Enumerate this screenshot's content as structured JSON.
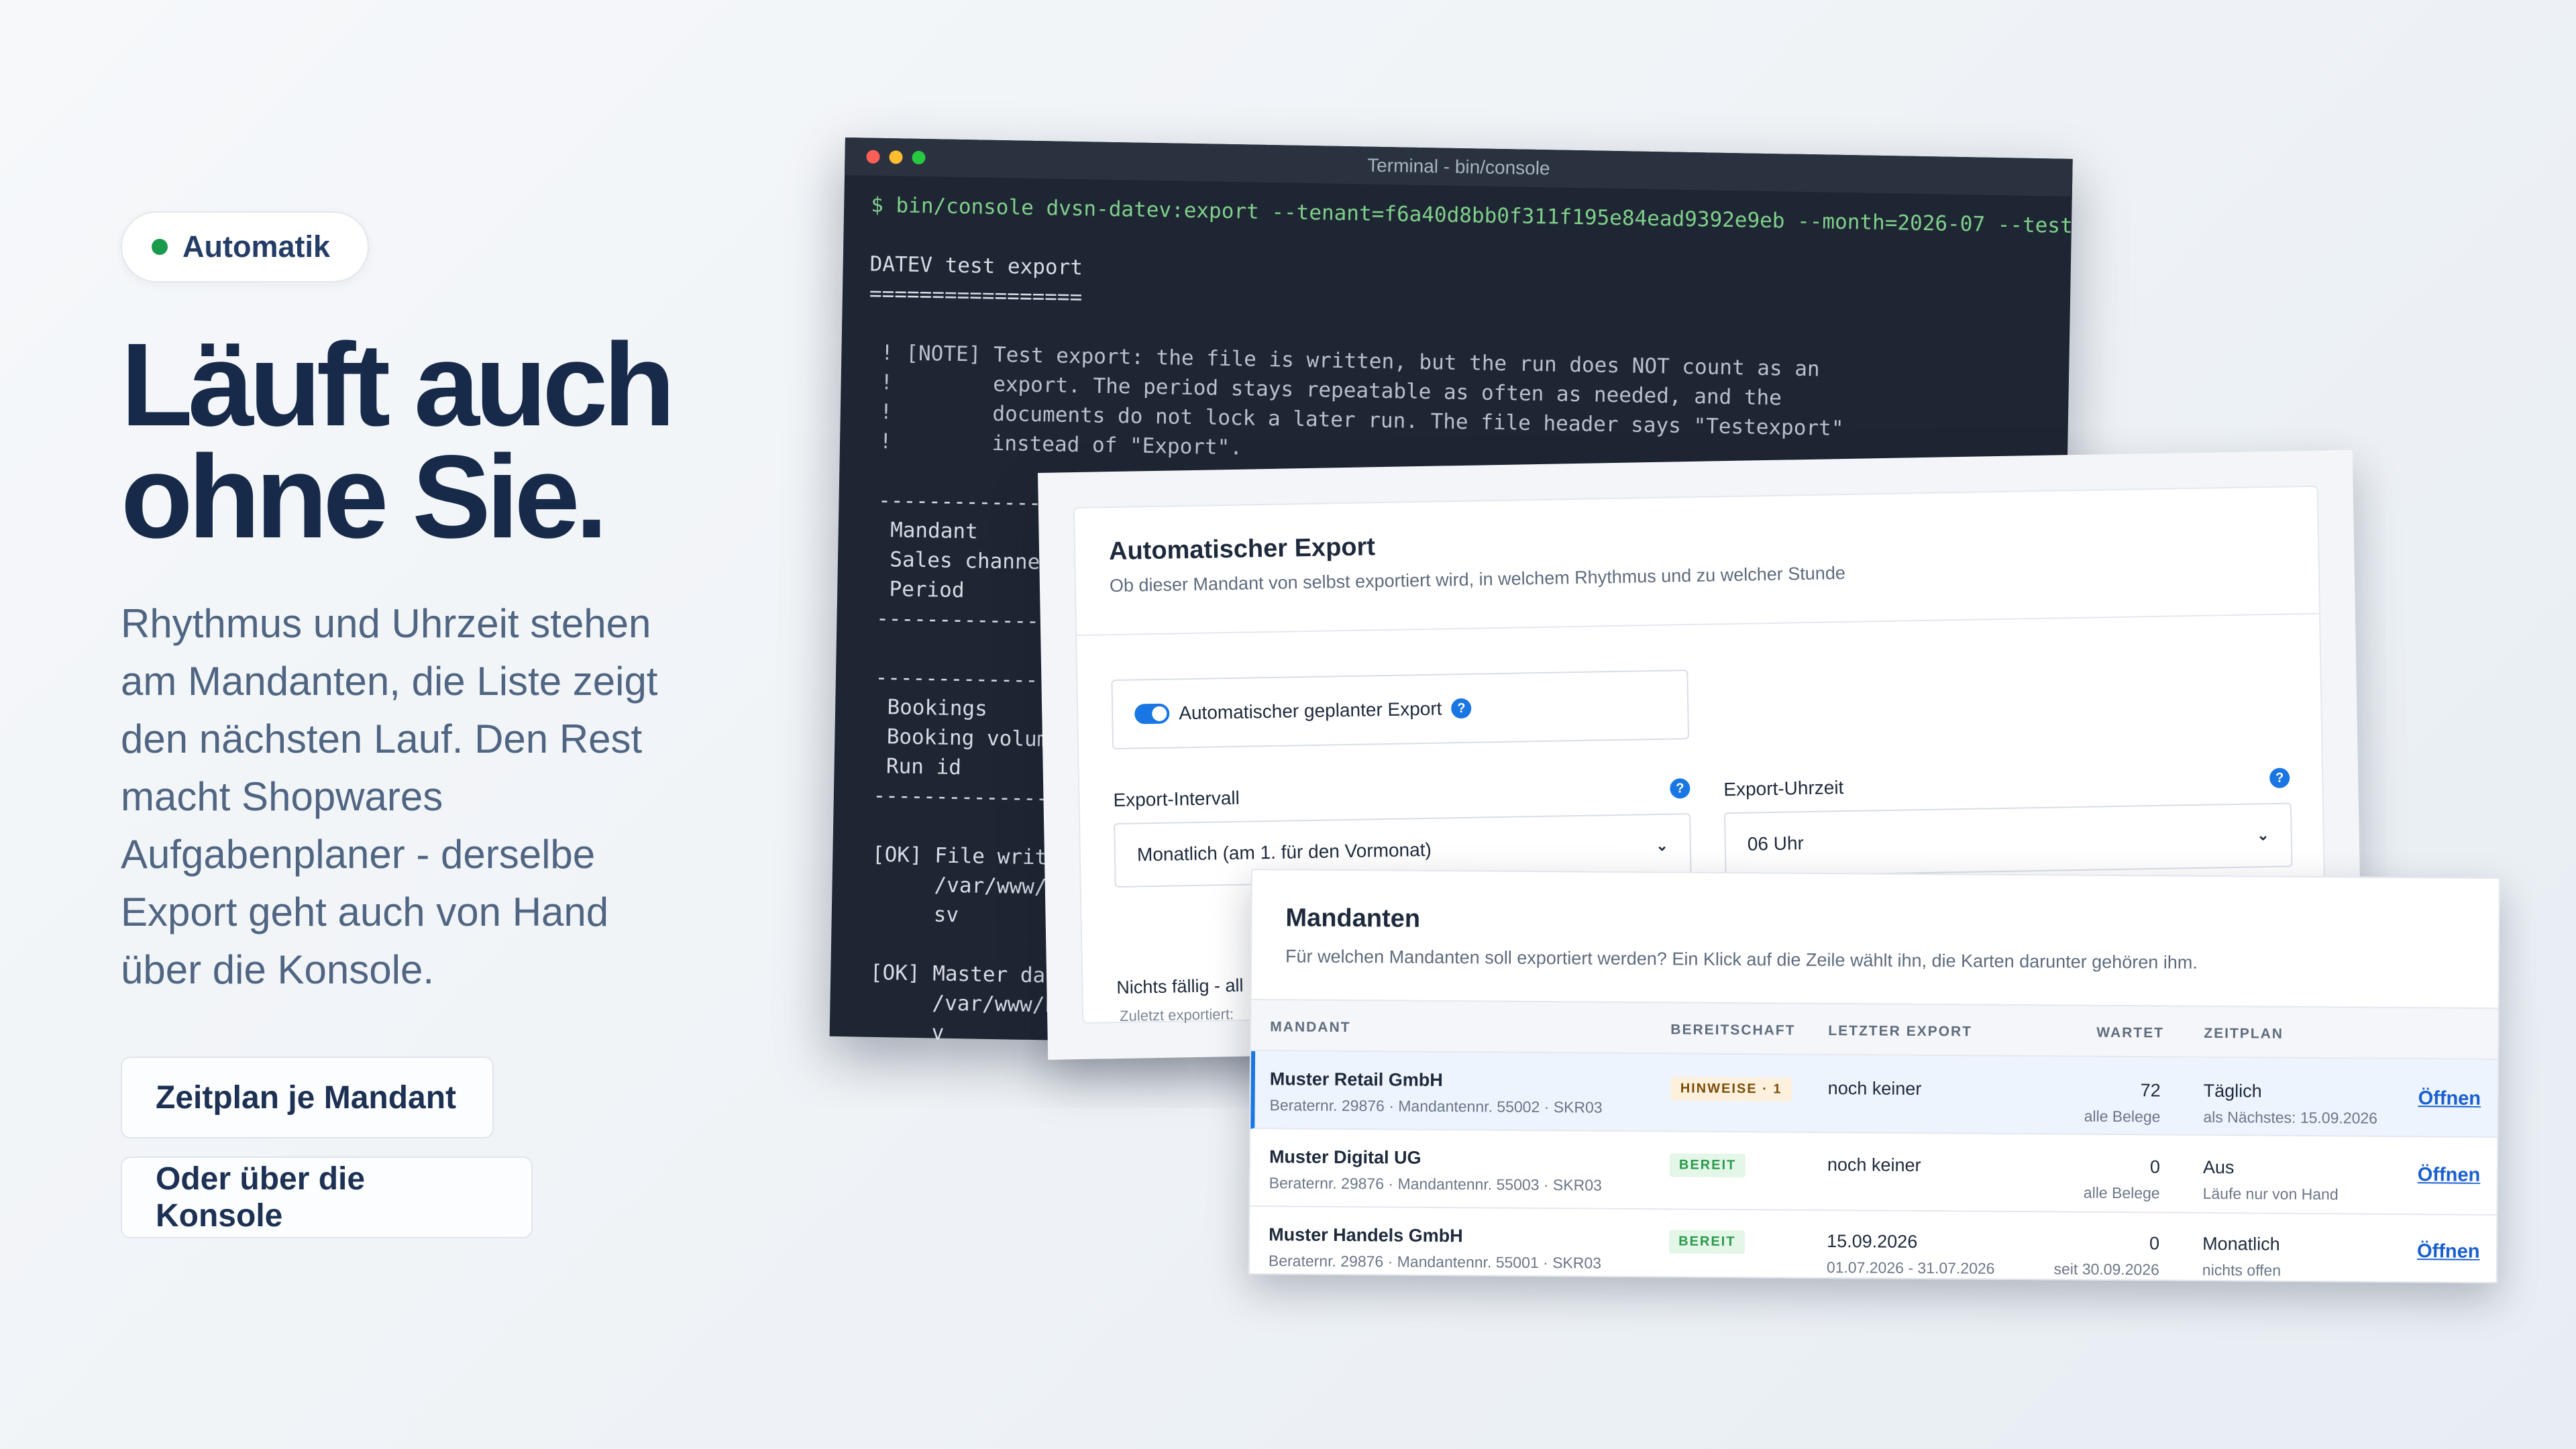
{
  "hero": {
    "badge": "Automatik",
    "headline_line1": "Läuft auch",
    "headline_line2": "ohne Sie.",
    "lead": "Rhythmus und Uhrzeit stehen am Mandanten, die Liste zeigt den nächsten Lauf. Den Rest macht Shopwares Aufgabenplaner - derselbe Export geht auch von Hand über die Konsole.",
    "button_primary": "Zeitplan je Mandant",
    "button_secondary": "Oder über die Konsole"
  },
  "terminal": {
    "title": "Terminal - bin/console",
    "lines": [
      "$ bin/console dvsn-datev:export --tenant=f6a40d8bb0f311f195e84ead9392e9eb --month=2026-07 --test",
      "",
      "DATEV test export",
      "=================",
      "",
      " ! [NOTE] Test export: the file is written, but the run does NOT count as an",
      " !        export. The period stays repeatable as often as needed, and the",
      " !        documents do not lock a later run. The file header says \"Testexport\"",
      " !        instead of \"Export\".",
      "",
      " ------------------------",
      "  Mandant",
      "  Sales channe",
      "  Period",
      " ------------------------",
      "",
      " ------------------------",
      "  Bookings",
      "  Booking volum",
      "  Run id",
      " ------------------------",
      "",
      " [OK] File writ",
      "      /var/www/h",
      "      sv",
      "",
      " [OK] Master dat",
      "      /var/www/h",
      "      v"
    ]
  },
  "settings": {
    "title": "Automatischer Export",
    "subtitle": "Ob dieser Mandant von selbst exportiert wird, in welchem Rhythmus und zu welcher Stunde",
    "toggle_label": "Automatischer geplanter Export",
    "toggle_on": true,
    "help_glyph": "?",
    "interval_label": "Export-Intervall",
    "interval_value": "Monatlich (am 1. für den Vormonat)",
    "time_label": "Export-Uhrzeit",
    "time_value": "06 Uhr",
    "due_text": "Nichts fällig - all",
    "last_text": "Zuletzt exportiert:"
  },
  "clients": {
    "title": "Mandanten",
    "subtitle": "Für welchen Mandanten soll exportiert werden? Ein Klick auf die Zeile wählt ihn, die Karten darunter gehören ihm.",
    "columns": [
      "MANDANT",
      "BEREITSCHAFT",
      "LETZTER EXPORT",
      "WARTET",
      "ZEITPLAN"
    ],
    "rows": [
      {
        "name": "Muster Retail GmbH",
        "meta": "Beraternr. 29876 · Mandantennr. 55002 · SKR03",
        "status": "HINWEISE · 1",
        "last_export": "noch keiner",
        "last_export_range": "",
        "waiting": "72",
        "waiting_sub": "alle Belege",
        "schedule": "Täglich",
        "schedule_sub": "als Nächstes: 15.09.2026",
        "action": "Öffnen"
      },
      {
        "name": "Muster Digital UG",
        "meta": "Beraternr. 29876 · Mandantennr. 55003 · SKR03",
        "status": "BEREIT",
        "last_export": "noch keiner",
        "last_export_range": "",
        "waiting": "0",
        "waiting_sub": "alle Belege",
        "schedule": "Aus",
        "schedule_sub": "Läufe nur von Hand",
        "action": "Öffnen"
      },
      {
        "name": "Muster Handels GmbH",
        "meta": "Beraternr. 29876 · Mandantennr. 55001 · SKR03",
        "status": "BEREIT",
        "last_export": "15.09.2026",
        "last_export_range": "01.07.2026 - 31.07.2026",
        "waiting": "0",
        "waiting_sub": "seit 30.09.2026",
        "schedule": "Monatlich",
        "schedule_sub": "nichts offen",
        "action": "Öffnen"
      }
    ]
  },
  "colors": {
    "accent": "#1976e3",
    "status_ok": "#2b9a4b",
    "status_warn": "#7a4d0a",
    "badge_dot": "#1a9a4c",
    "terminal_bg": "#1f2633"
  }
}
